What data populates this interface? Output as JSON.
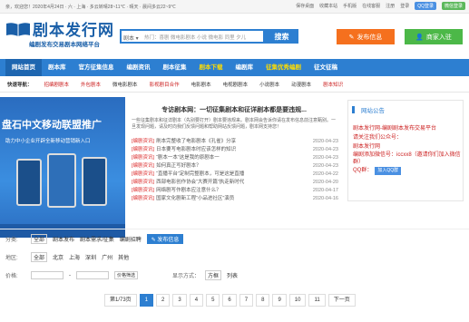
{
  "topbar": {
    "left_text": "亲，欢迎您！2020年4月24日 · 六 · 上海 · 多云转晴28~11℃ · 晴天 · 晨间多云22~9℃",
    "links": [
      "保存桌面",
      "收藏本站",
      "手机版",
      "在线客服",
      "注册",
      "登录"
    ],
    "qq_label": "QQ登录",
    "wx_label": "微信登录"
  },
  "header": {
    "logo_title": "剧本发行网",
    "logo_subtitle": "编剧发布交易剧本网络平台",
    "search_select": "剧本",
    "search_placeholder": "热门：喜剧 微电影剧本 小说 微电影 同里 夕儿",
    "search_button": "搜索",
    "publish_button": "发布信息",
    "merchant_button": "商家入驻"
  },
  "nav": {
    "items": [
      "网站首页",
      "剧本库",
      "官方征集信息",
      "编剧资讯",
      "剧本征集",
      "剧本下载",
      "编剧库",
      "征集优秀编剧",
      "征文征稿"
    ]
  },
  "quick": {
    "label": "快速导航：",
    "items": [
      "招编剧剧本",
      "外包剧本",
      "微电影剧本",
      "影视剧目合作",
      "电影剧本",
      "电视剧剧本",
      "小说剧本",
      "动漫剧本",
      "剧本知识"
    ]
  },
  "banner": {
    "headline": "盘石中文移动联盟推广",
    "subline": "助力中小企业开辟全新移动营销新入口"
  },
  "news": {
    "headline": "专访剧本网：一切征集剧本和征详剧本都是要违规...",
    "intro": "一些征集剧本和征详剧本（先别要打开）剧本要违规来。剧本网会告诉你请在发布信息前注意甄别。一旦发现问题，请及时向我们反馈问题和帮助网站反馈问题，剧本网支持您！",
    "rows": [
      {
        "cat": "[编剧资讯]",
        "title": "刷本完整收了电影剧本《孔雀》分享",
        "date": "2020-04-23"
      },
      {
        "cat": "[编剧资讯]",
        "title": "日本要写电影剧本时应该怎样的知识",
        "date": "2020-04-23"
      },
      {
        "cat": "[编剧资讯]",
        "title": "“剧本一本”这是我的原剧本一",
        "date": "2020-04-23"
      },
      {
        "cat": "[编剧资讯]",
        "title": "如何真正写好剧本？",
        "date": "2020-04-23"
      },
      {
        "cat": "[编剧资讯]",
        "title": "“直播平台”定制完整剧本，可是这是直播",
        "date": "2020-04-22"
      },
      {
        "cat": "[编剧资讯]",
        "title": "西部电影创作协会“大赛开篇”执走新时代",
        "date": "2020-04-20"
      },
      {
        "cat": "[编剧资讯]",
        "title": "网络剧写作剧本应注意什么？",
        "date": "2020-04-17"
      },
      {
        "cat": "[编剧资讯]",
        "title": "国家文化剧新工程“小品进社区”演员",
        "date": "2020-04-16"
      }
    ]
  },
  "notice": {
    "title": "网站公告",
    "lines": [
      "剧本发行网-编剧剧本发布交易平台",
      "请关注我们公众号：",
      "剧本发行网",
      "编剧添加微信号：iccxx8（邀请你们加入微信群）",
      "QQ群："
    ],
    "qq_group_label": "加入QQ群"
  },
  "filter": {
    "category_label": "分类:",
    "category_options": [
      "全部",
      "剧本发布",
      "剧本需求/征集",
      "编剧招聘"
    ],
    "publish_label": "发布信息",
    "region_label": "地区:",
    "region_options": [
      "全部",
      "北京",
      "上海",
      "深圳",
      "广州",
      "其他"
    ],
    "price_label": "价格:",
    "price_sep": "-",
    "price_button": "价格筛选",
    "display_label": "显示方式：",
    "display_options": [
      "方框",
      "列表"
    ]
  },
  "pager": {
    "info": "第1/73页",
    "pages": [
      "1",
      "2",
      "3",
      "4",
      "5",
      "6",
      "7",
      "8",
      "9",
      "10",
      "11"
    ],
    "next": "下一页",
    "current": "1"
  }
}
